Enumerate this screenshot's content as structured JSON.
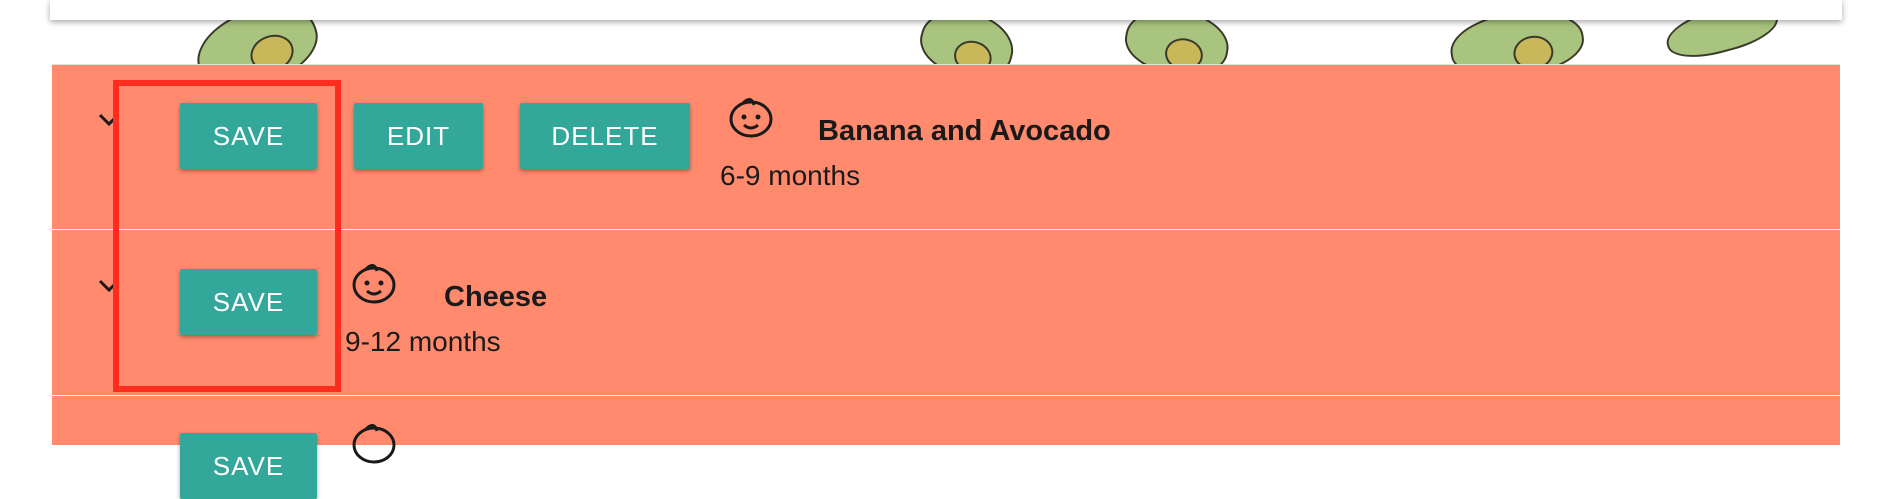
{
  "colors": {
    "list_background": "#ff8a6d",
    "button_background": "#33a89a",
    "highlight_border": "#ff2d1f"
  },
  "foods": [
    {
      "buttons": {
        "save": "SAVE",
        "edit": "EDIT",
        "delete": "DELETE"
      },
      "icon": "baby-face-icon",
      "name": "Banana and Avocado",
      "age": "6-9 months"
    },
    {
      "buttons": {
        "save": "SAVE"
      },
      "icon": "baby-face-icon",
      "name": "Cheese",
      "age": "9-12 months"
    },
    {
      "buttons": {
        "save": "SAVE"
      },
      "icon": "baby-face-icon"
    }
  ]
}
